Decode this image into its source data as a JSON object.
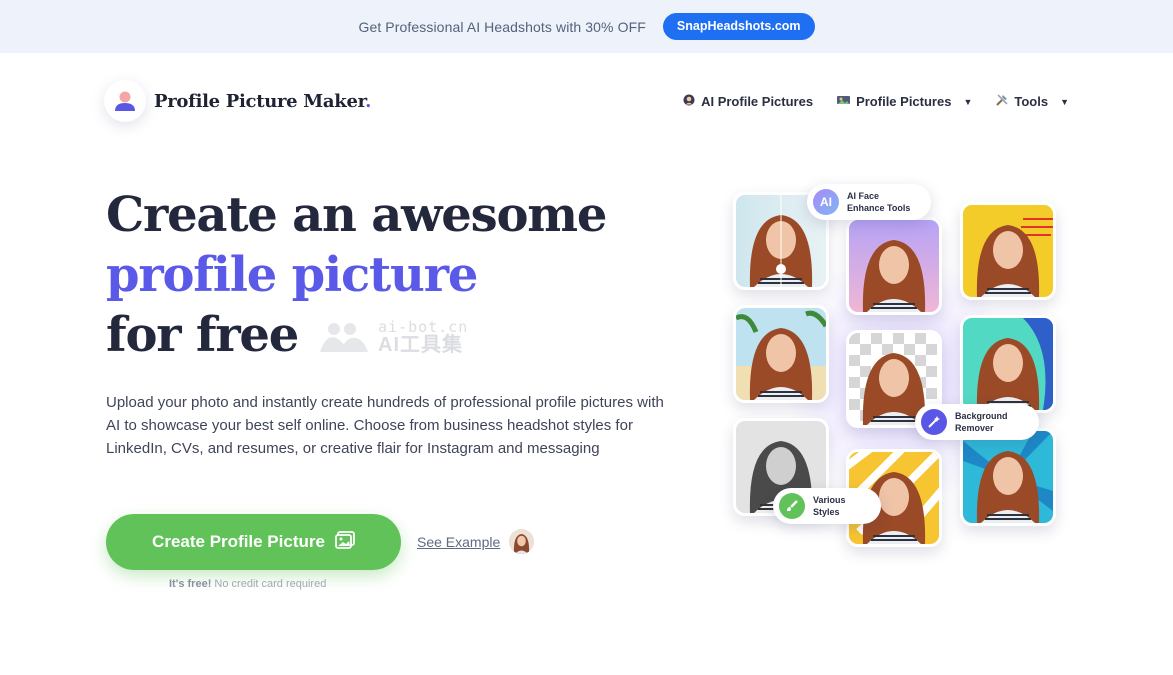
{
  "promo": {
    "text": "Get Professional AI Headshots with 30% OFF",
    "button_label": "SnapHeadshots.com",
    "accent_color": "#1f6ff2"
  },
  "header": {
    "logo_text": "Profile Picture Maker",
    "logo_dot": ".",
    "nav": [
      {
        "icon": "ai-face-icon",
        "label": "AI Profile Pictures",
        "has_dropdown": false
      },
      {
        "icon": "gallery-icon",
        "label": "Profile Pictures",
        "has_dropdown": true
      },
      {
        "icon": "tools-icon",
        "label": "Tools",
        "has_dropdown": true
      }
    ]
  },
  "hero": {
    "title_line1": "Create an awesome",
    "title_line2": "profile picture",
    "title_line3": "for free",
    "description": "Upload your photo and instantly create hundreds of professional profile pictures with AI to showcase your best self online. Choose from business headshot styles for LinkedIn, CVs, and resumes, or creative flair for Instagram and messaging",
    "cta_label": "Create Profile Picture",
    "see_example_label": "See Example",
    "free_bold": "It's free!",
    "free_rest": "No credit card required",
    "accent_color": "#5b5ae8",
    "cta_color": "#62c25a"
  },
  "watermark": {
    "top": "ai-bot.cn",
    "bottom": "AI工具集"
  },
  "collage": {
    "badges": [
      {
        "icon_text": "AI",
        "line1": "AI Face",
        "line2": "Enhance Tools"
      },
      {
        "icon": "magic-wand-icon",
        "line1": "Background",
        "line2": "Remover"
      },
      {
        "icon": "brush-icon",
        "line1": "Various",
        "line2": "Styles"
      }
    ]
  }
}
